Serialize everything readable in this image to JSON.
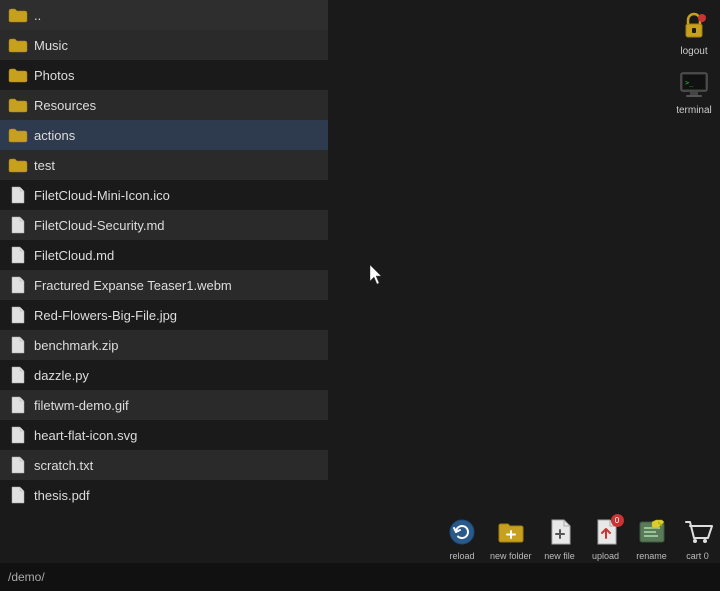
{
  "files": [
    {
      "name": "..",
      "type": "folder",
      "selected": false
    },
    {
      "name": "Music",
      "type": "folder",
      "selected": false
    },
    {
      "name": "Photos",
      "type": "folder",
      "selected": false
    },
    {
      "name": "Resources",
      "type": "folder",
      "selected": false
    },
    {
      "name": "actions",
      "type": "folder",
      "selected": true
    },
    {
      "name": "test",
      "type": "folder",
      "selected": false
    },
    {
      "name": "FiletCloud-Mini-Icon.ico",
      "type": "file",
      "selected": false
    },
    {
      "name": "FiletCloud-Security.md",
      "type": "file",
      "selected": false
    },
    {
      "name": "FiletCloud.md",
      "type": "file",
      "selected": false
    },
    {
      "name": "Fractured Expanse Teaser1.webm",
      "type": "file",
      "selected": false
    },
    {
      "name": "Red-Flowers-Big-File.jpg",
      "type": "file",
      "selected": false
    },
    {
      "name": "benchmark.zip",
      "type": "file",
      "selected": false
    },
    {
      "name": "dazzle.py",
      "type": "file",
      "selected": false
    },
    {
      "name": "filetwm-demo.gif",
      "type": "file",
      "selected": false
    },
    {
      "name": "heart-flat-icon.svg",
      "type": "file",
      "selected": false
    },
    {
      "name": "scratch.txt",
      "type": "file",
      "selected": false
    },
    {
      "name": "thesis.pdf",
      "type": "file",
      "selected": false
    }
  ],
  "statusBar": {
    "path": "/demo/"
  },
  "toolbar": {
    "buttons": [
      {
        "id": "reload",
        "label": "reload"
      },
      {
        "id": "new-folder",
        "label": "new\nfolder"
      },
      {
        "id": "new-file",
        "label": "new\nfile"
      },
      {
        "id": "upload",
        "label": "upload",
        "badge": "0"
      },
      {
        "id": "rename",
        "label": "rename"
      },
      {
        "id": "cart",
        "label": "cart\n0"
      }
    ]
  },
  "desktopIcons": [
    {
      "id": "logout",
      "label": "logout"
    },
    {
      "id": "terminal",
      "label": "terminal"
    }
  ]
}
